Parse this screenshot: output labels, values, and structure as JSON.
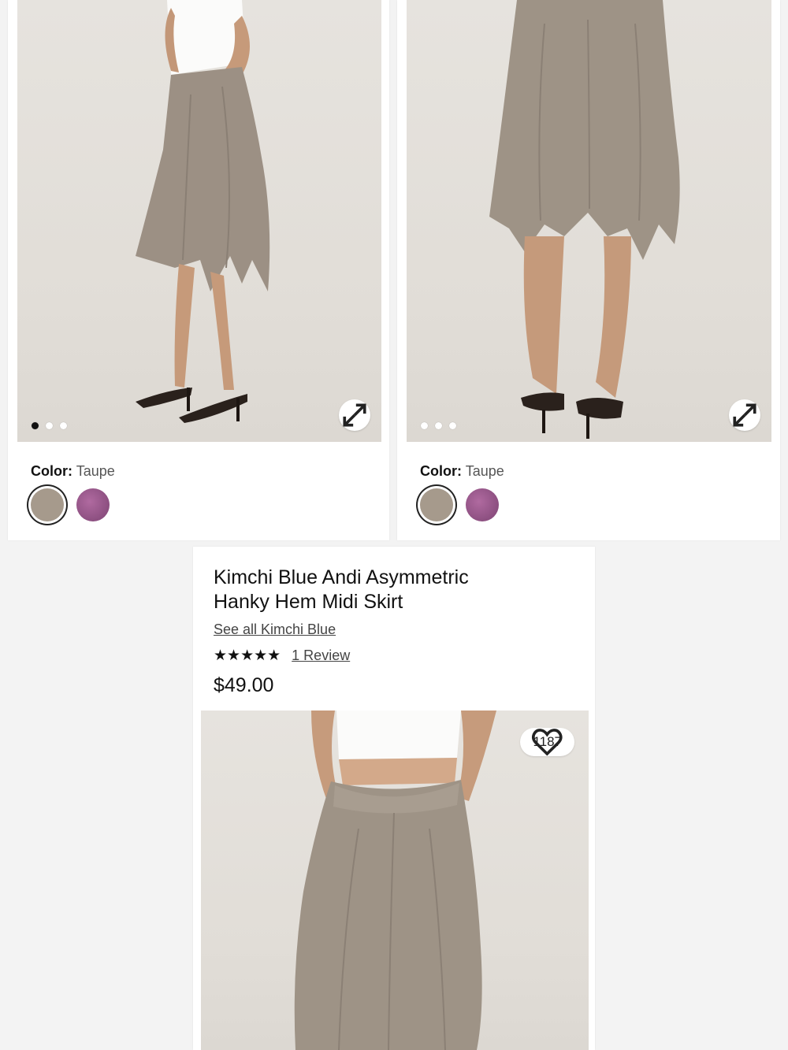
{
  "listings": [
    {
      "color_label": "Color:",
      "color_value": "Taupe",
      "carousel_total": 3,
      "carousel_active": 1,
      "swatch_colors": [
        "#a69a8c",
        "#9b5a8e"
      ],
      "expand_icon": "expand-arrows-icon"
    },
    {
      "color_label": "Color:",
      "color_value": "Taupe",
      "carousel_total": 3,
      "carousel_active": 0,
      "swatch_colors": [
        "#a69a8c",
        "#9b5a8e"
      ],
      "expand_icon": "expand-arrows-icon"
    }
  ],
  "product": {
    "title_line1": "Kimchi Blue Andi Asymmetric",
    "title_line2": "Hanky Hem Midi Skirt",
    "brand_link": "See all Kimchi Blue",
    "stars": "★★★★★",
    "rating_value": 5,
    "review_link": "1 Review",
    "price": "$49.00",
    "favorites_count": "1187",
    "favorite_icon": "heart-outline-icon"
  }
}
